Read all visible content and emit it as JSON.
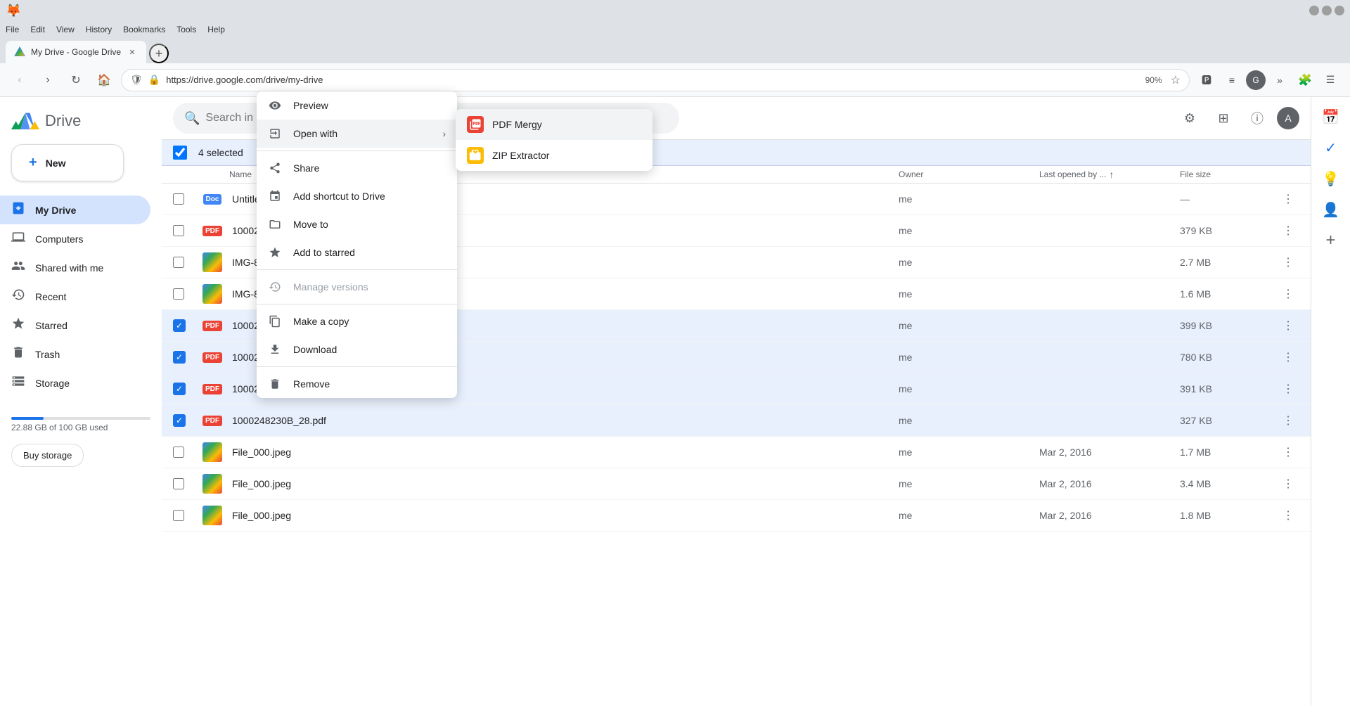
{
  "browser": {
    "menu_items": [
      "File",
      "Edit",
      "View",
      "History",
      "Bookmarks",
      "Tools",
      "Help"
    ],
    "tab_title": "My Drive - Google Drive",
    "url": "https://drive.google.com/drive/my-drive",
    "zoom": "90%",
    "new_tab_label": "+"
  },
  "sidebar": {
    "logo_text": "Drive",
    "new_button_label": "New",
    "items": [
      {
        "id": "my-drive",
        "label": "My Drive",
        "active": true
      },
      {
        "id": "computers",
        "label": "Computers"
      },
      {
        "id": "shared-with-me",
        "label": "Shared with me"
      },
      {
        "id": "recent",
        "label": "Recent"
      },
      {
        "id": "starred",
        "label": "Starred"
      },
      {
        "id": "trash",
        "label": "Trash"
      },
      {
        "id": "storage",
        "label": "Storage"
      }
    ],
    "storage_text": "22.88 GB of 100 GB used",
    "buy_storage_label": "Buy storage"
  },
  "main": {
    "search_placeholder": "Search in Drive",
    "selected_count": "4 selected",
    "columns": {
      "name": "Name",
      "owner": "Owner",
      "last_opened": "Last opened by ...",
      "file_size": "File size"
    },
    "files": [
      {
        "id": 1,
        "name": "Untitled pr...",
        "type": "doc",
        "owner": "me",
        "opened": "",
        "size": "—",
        "selected": false,
        "checked": false
      },
      {
        "id": 2,
        "name": "100024823...",
        "type": "pdf",
        "owner": "me",
        "opened": "",
        "size": "379 KB",
        "selected": false,
        "checked": false
      },
      {
        "id": 3,
        "name": "IMG-8870...",
        "type": "img",
        "owner": "me",
        "opened": "",
        "size": "2.7 MB",
        "selected": false,
        "checked": false
      },
      {
        "id": 4,
        "name": "IMG-8873.j...",
        "type": "img",
        "owner": "me",
        "opened": "",
        "size": "1.6 MB",
        "selected": false,
        "checked": false
      },
      {
        "id": 5,
        "name": "1000248230B_26.pdf",
        "type": "pdf",
        "owner": "me",
        "opened": "",
        "size": "399 KB",
        "selected": true,
        "checked": true
      },
      {
        "id": 6,
        "name": "1000248233A_1.pdf",
        "type": "pdf",
        "owner": "me",
        "opened": "",
        "size": "780 KB",
        "selected": true,
        "checked": true
      },
      {
        "id": 7,
        "name": "1000248233B_1.pdf",
        "type": "pdf",
        "owner": "me",
        "opened": "",
        "size": "391 KB",
        "selected": true,
        "checked": true
      },
      {
        "id": 8,
        "name": "1000248230B_28.pdf",
        "type": "pdf",
        "owner": "me",
        "opened": "",
        "size": "327 KB",
        "selected": true,
        "checked": true
      },
      {
        "id": 9,
        "name": "File_000.jpeg",
        "type": "img",
        "owner": "me",
        "opened": "Mar 2, 2016",
        "size": "1.7 MB",
        "selected": false,
        "checked": false
      },
      {
        "id": 10,
        "name": "File_000.jpeg",
        "type": "img",
        "owner": "me",
        "opened": "Mar 2, 2016",
        "size": "3.4 MB",
        "selected": false,
        "checked": false
      },
      {
        "id": 11,
        "name": "File_000.jpeg",
        "type": "img",
        "owner": "me",
        "opened": "Mar 2, 2016",
        "size": "1.8 MB",
        "selected": false,
        "checked": false
      }
    ]
  },
  "context_menu": {
    "items": [
      {
        "id": "preview",
        "label": "Preview",
        "icon": "eye",
        "has_arrow": false,
        "disabled": false
      },
      {
        "id": "open-with",
        "label": "Open with",
        "icon": "open",
        "has_arrow": true,
        "disabled": false,
        "active": true
      },
      {
        "id": "share",
        "label": "Share",
        "icon": "share",
        "has_arrow": false,
        "disabled": false
      },
      {
        "id": "add-shortcut",
        "label": "Add shortcut to Drive",
        "icon": "shortcut",
        "has_arrow": false,
        "disabled": false
      },
      {
        "id": "move-to",
        "label": "Move to",
        "icon": "move",
        "has_arrow": false,
        "disabled": false
      },
      {
        "id": "add-to-starred",
        "label": "Add to starred",
        "icon": "star",
        "has_arrow": false,
        "disabled": false
      },
      {
        "id": "manage-versions",
        "label": "Manage versions",
        "icon": "versions",
        "has_arrow": false,
        "disabled": true
      },
      {
        "id": "make-copy",
        "label": "Make a copy",
        "icon": "copy",
        "has_arrow": false,
        "disabled": false
      },
      {
        "id": "download",
        "label": "Download",
        "icon": "download",
        "has_arrow": false,
        "disabled": false
      },
      {
        "id": "remove",
        "label": "Remove",
        "icon": "trash",
        "has_arrow": false,
        "disabled": false
      }
    ],
    "submenu": [
      {
        "id": "pdf-mergy",
        "label": "PDF Mergy",
        "color": "#ea4335"
      },
      {
        "id": "zip-extractor",
        "label": "ZIP Extractor",
        "color": "#fbbc05"
      }
    ]
  }
}
